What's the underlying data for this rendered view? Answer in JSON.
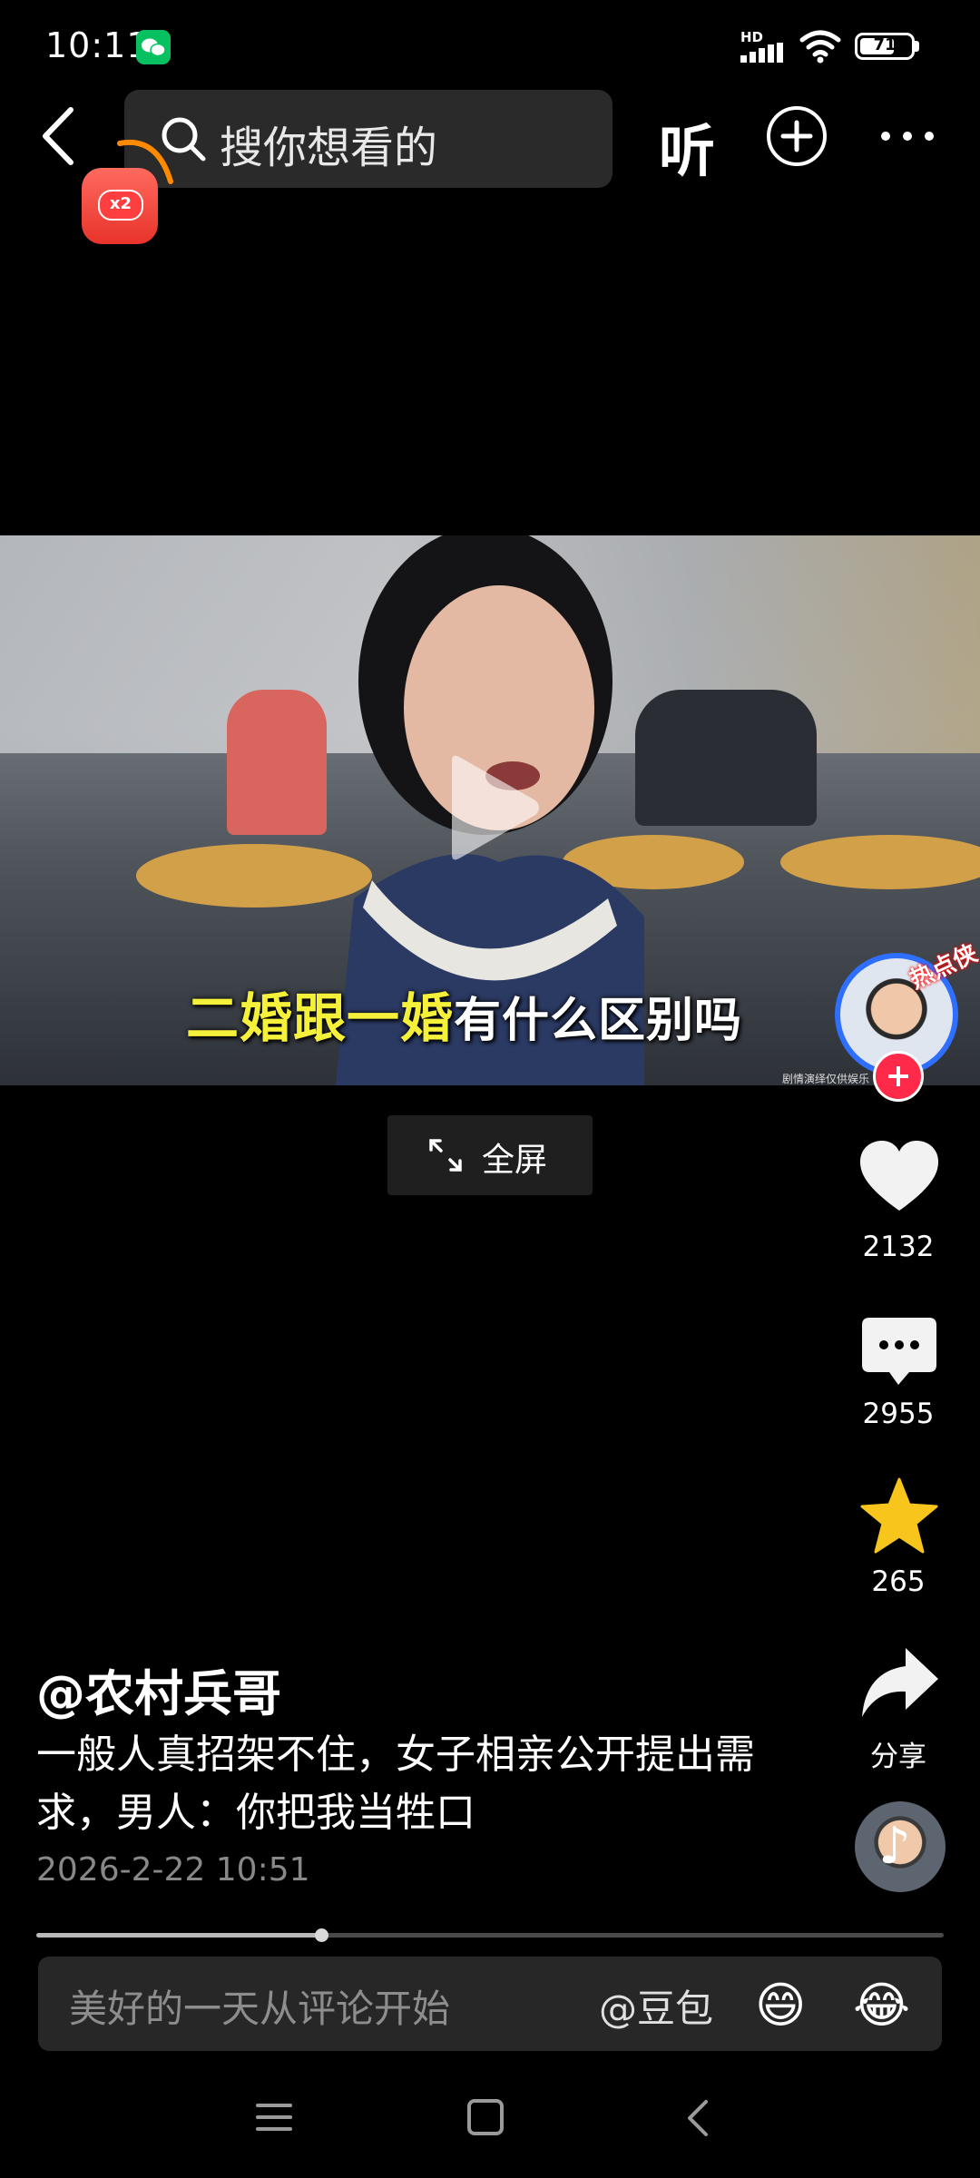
{
  "status_bar": {
    "time": "10:11",
    "network_label": "HD",
    "battery": "71",
    "battery_level": 0.71
  },
  "top_nav": {
    "search_placeholder": "搜你想看的",
    "listen_label": "听",
    "redpack_badge": "x2"
  },
  "video": {
    "caption_highlight": "二婚跟一婚",
    "caption_rest": "有什么区别吗",
    "watermark": "剧情演绎仅供娱乐\n无不良引导"
  },
  "fullscreen": {
    "label": "全屏"
  },
  "right_rail": {
    "hot_tag": "热点侠",
    "likes": "2132",
    "comments": "2955",
    "favorites": "265",
    "share_label": "分享"
  },
  "post": {
    "author": "@农村兵哥",
    "description": "一般人真招架不住，女子相亲公开提出需求，男人：你把我当牲口",
    "date": "2026-2-22 10:51",
    "progress": 0.314
  },
  "comment_bar": {
    "placeholder": "美好的一天从评论开始",
    "mention": "@豆包",
    "emoji_1": "😄",
    "emoji_2": "😂"
  },
  "colors": {
    "background": "#000000",
    "caption_yellow": "#f5f03a",
    "follow_red": "#ff2a4a",
    "favorite_yellow": "#f7c51c",
    "wechat_green": "#07c160"
  }
}
